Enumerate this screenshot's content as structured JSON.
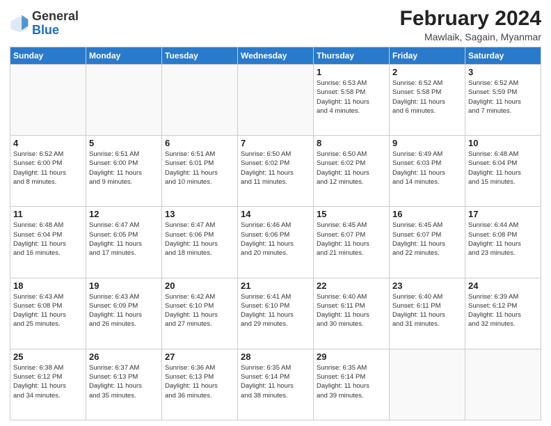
{
  "logo": {
    "general": "General",
    "blue": "Blue"
  },
  "title": {
    "month_year": "February 2024",
    "location": "Mawlaik, Sagain, Myanmar"
  },
  "headers": [
    "Sunday",
    "Monday",
    "Tuesday",
    "Wednesday",
    "Thursday",
    "Friday",
    "Saturday"
  ],
  "weeks": [
    [
      {
        "day": "",
        "info": ""
      },
      {
        "day": "",
        "info": ""
      },
      {
        "day": "",
        "info": ""
      },
      {
        "day": "",
        "info": ""
      },
      {
        "day": "1",
        "info": "Sunrise: 6:53 AM\nSunset: 5:58 PM\nDaylight: 11 hours\nand 4 minutes."
      },
      {
        "day": "2",
        "info": "Sunrise: 6:52 AM\nSunset: 5:58 PM\nDaylight: 11 hours\nand 6 minutes."
      },
      {
        "day": "3",
        "info": "Sunrise: 6:52 AM\nSunset: 5:59 PM\nDaylight: 11 hours\nand 7 minutes."
      }
    ],
    [
      {
        "day": "4",
        "info": "Sunrise: 6:52 AM\nSunset: 6:00 PM\nDaylight: 11 hours\nand 8 minutes."
      },
      {
        "day": "5",
        "info": "Sunrise: 6:51 AM\nSunset: 6:00 PM\nDaylight: 11 hours\nand 9 minutes."
      },
      {
        "day": "6",
        "info": "Sunrise: 6:51 AM\nSunset: 6:01 PM\nDaylight: 11 hours\nand 10 minutes."
      },
      {
        "day": "7",
        "info": "Sunrise: 6:50 AM\nSunset: 6:02 PM\nDaylight: 11 hours\nand 11 minutes."
      },
      {
        "day": "8",
        "info": "Sunrise: 6:50 AM\nSunset: 6:02 PM\nDaylight: 11 hours\nand 12 minutes."
      },
      {
        "day": "9",
        "info": "Sunrise: 6:49 AM\nSunset: 6:03 PM\nDaylight: 11 hours\nand 14 minutes."
      },
      {
        "day": "10",
        "info": "Sunrise: 6:48 AM\nSunset: 6:04 PM\nDaylight: 11 hours\nand 15 minutes."
      }
    ],
    [
      {
        "day": "11",
        "info": "Sunrise: 6:48 AM\nSunset: 6:04 PM\nDaylight: 11 hours\nand 16 minutes."
      },
      {
        "day": "12",
        "info": "Sunrise: 6:47 AM\nSunset: 6:05 PM\nDaylight: 11 hours\nand 17 minutes."
      },
      {
        "day": "13",
        "info": "Sunrise: 6:47 AM\nSunset: 6:06 PM\nDaylight: 11 hours\nand 18 minutes."
      },
      {
        "day": "14",
        "info": "Sunrise: 6:46 AM\nSunset: 6:06 PM\nDaylight: 11 hours\nand 20 minutes."
      },
      {
        "day": "15",
        "info": "Sunrise: 6:45 AM\nSunset: 6:07 PM\nDaylight: 11 hours\nand 21 minutes."
      },
      {
        "day": "16",
        "info": "Sunrise: 6:45 AM\nSunset: 6:07 PM\nDaylight: 11 hours\nand 22 minutes."
      },
      {
        "day": "17",
        "info": "Sunrise: 6:44 AM\nSunset: 6:08 PM\nDaylight: 11 hours\nand 23 minutes."
      }
    ],
    [
      {
        "day": "18",
        "info": "Sunrise: 6:43 AM\nSunset: 6:08 PM\nDaylight: 11 hours\nand 25 minutes."
      },
      {
        "day": "19",
        "info": "Sunrise: 6:43 AM\nSunset: 6:09 PM\nDaylight: 11 hours\nand 26 minutes."
      },
      {
        "day": "20",
        "info": "Sunrise: 6:42 AM\nSunset: 6:10 PM\nDaylight: 11 hours\nand 27 minutes."
      },
      {
        "day": "21",
        "info": "Sunrise: 6:41 AM\nSunset: 6:10 PM\nDaylight: 11 hours\nand 29 minutes."
      },
      {
        "day": "22",
        "info": "Sunrise: 6:40 AM\nSunset: 6:11 PM\nDaylight: 11 hours\nand 30 minutes."
      },
      {
        "day": "23",
        "info": "Sunrise: 6:40 AM\nSunset: 6:11 PM\nDaylight: 11 hours\nand 31 minutes."
      },
      {
        "day": "24",
        "info": "Sunrise: 6:39 AM\nSunset: 6:12 PM\nDaylight: 11 hours\nand 32 minutes."
      }
    ],
    [
      {
        "day": "25",
        "info": "Sunrise: 6:38 AM\nSunset: 6:12 PM\nDaylight: 11 hours\nand 34 minutes."
      },
      {
        "day": "26",
        "info": "Sunrise: 6:37 AM\nSunset: 6:13 PM\nDaylight: 11 hours\nand 35 minutes."
      },
      {
        "day": "27",
        "info": "Sunrise: 6:36 AM\nSunset: 6:13 PM\nDaylight: 11 hours\nand 36 minutes."
      },
      {
        "day": "28",
        "info": "Sunrise: 6:35 AM\nSunset: 6:14 PM\nDaylight: 11 hours\nand 38 minutes."
      },
      {
        "day": "29",
        "info": "Sunrise: 6:35 AM\nSunset: 6:14 PM\nDaylight: 11 hours\nand 39 minutes."
      },
      {
        "day": "",
        "info": ""
      },
      {
        "day": "",
        "info": ""
      }
    ]
  ]
}
